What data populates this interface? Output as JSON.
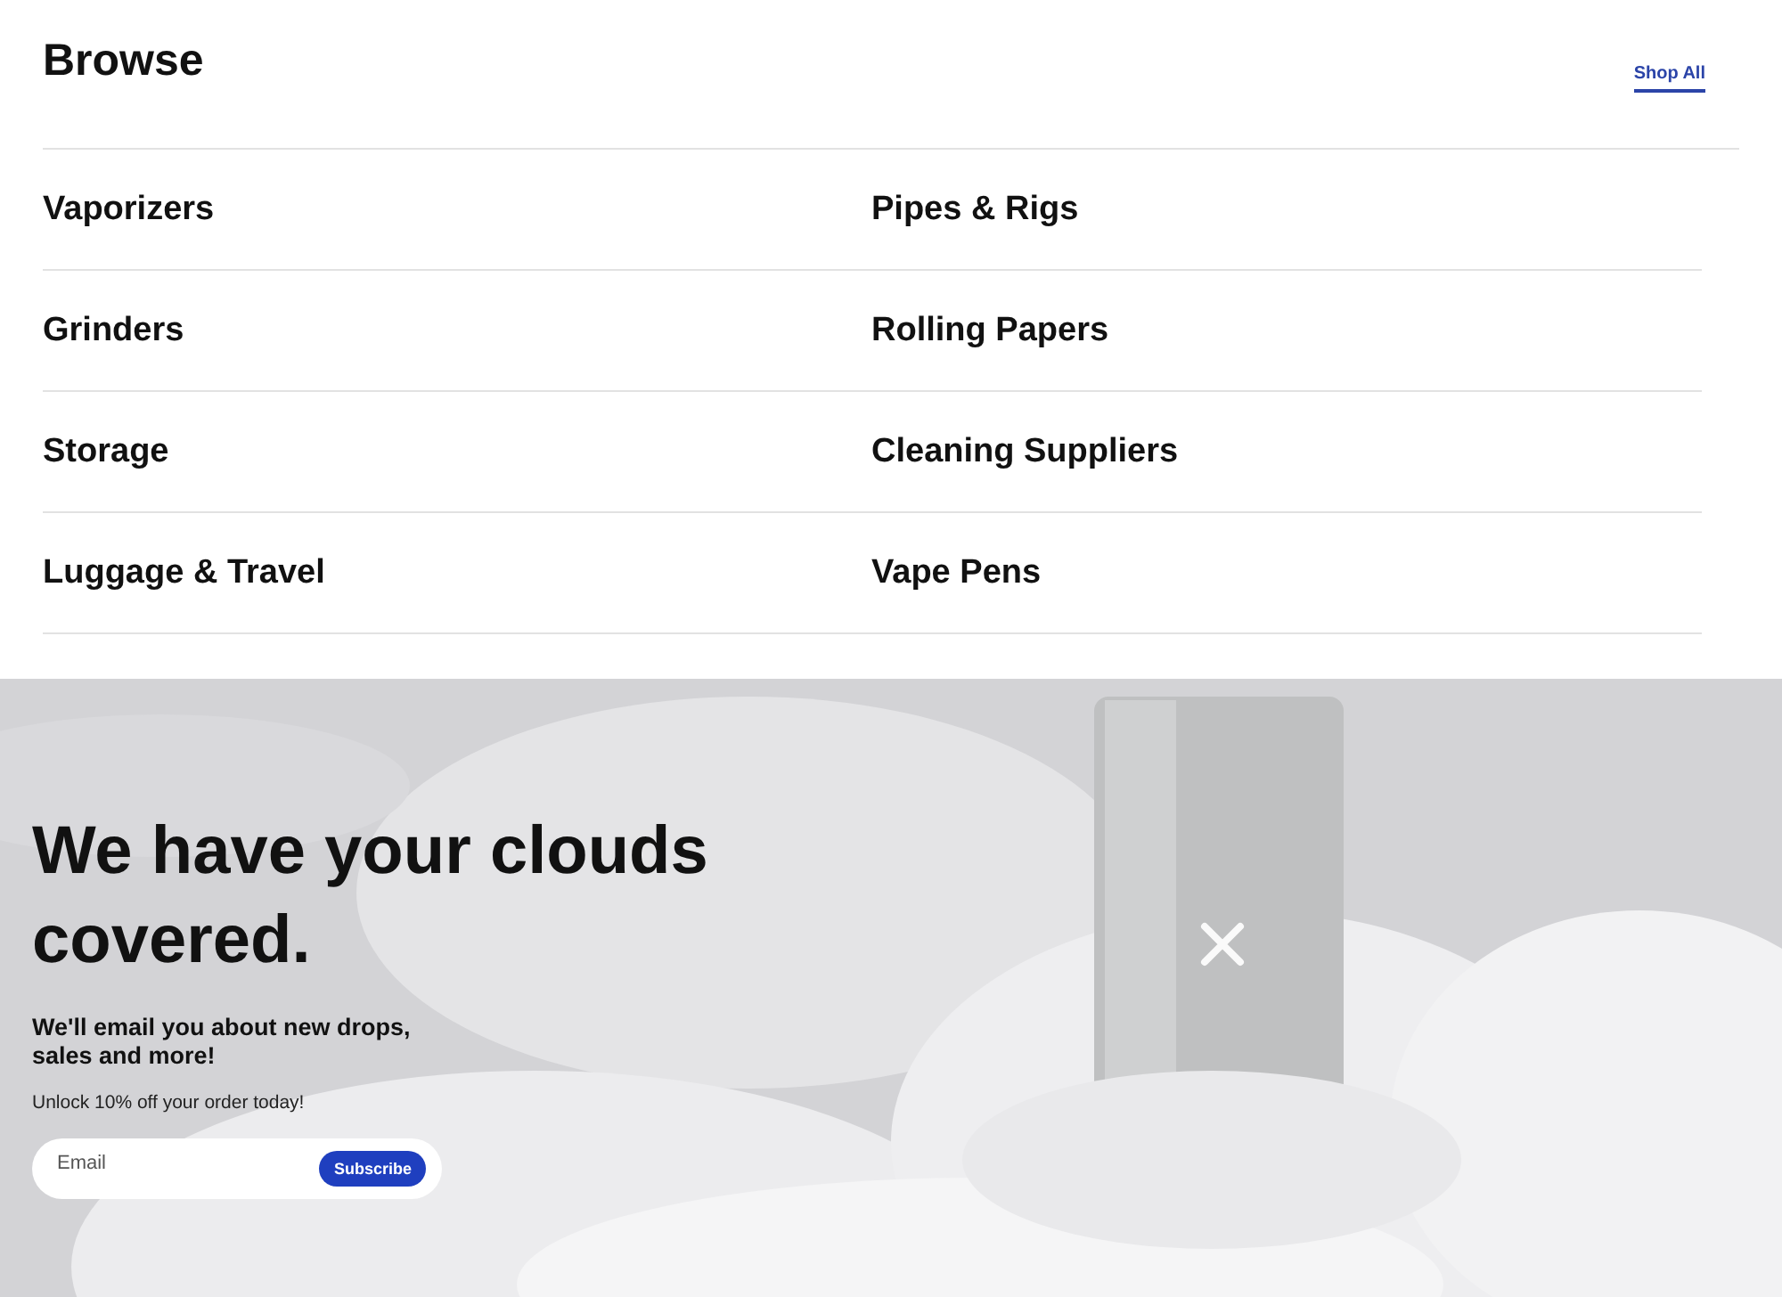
{
  "browse": {
    "title": "Browse",
    "link": "Shop All",
    "categories": [
      "Vaporizers",
      "Pipes & Rigs",
      "Grinders",
      "Rolling Papers",
      "Storage",
      "Cleaning Suppliers",
      "Luggage & Travel",
      "Vape Pens"
    ]
  },
  "hero": {
    "kind": "picture",
    "heading": "We have your clouds covered.",
    "subheading": "We'll email you about new drops, sales and more!",
    "offer": "Unlock 10% off your order today!",
    "email": {
      "placeholder": "Email"
    },
    "button": "Subscribe"
  }
}
